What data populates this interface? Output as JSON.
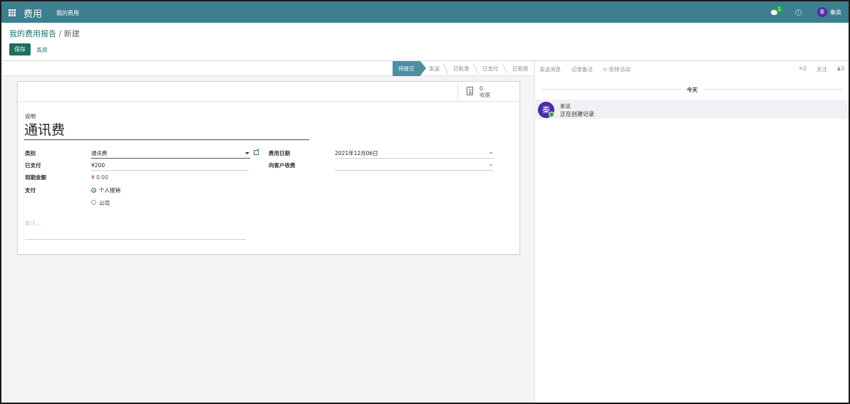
{
  "navbar": {
    "app_title": "费用",
    "menu_my_expenses": "我的费用",
    "chat_badge": "1",
    "user_avatar_initial": "秦",
    "user_name": "秦英"
  },
  "breadcrumb": {
    "parent": "我的费用报告",
    "separator": " / ",
    "current": "新建"
  },
  "buttons": {
    "save": "保存",
    "discard": "丢弃"
  },
  "statusbar": {
    "stages": [
      "待提交",
      "发送",
      "已批准",
      "已支付",
      "已拒绝"
    ],
    "active_index": 0
  },
  "button_box": {
    "receipt_count": "0",
    "receipt_label": "收据"
  },
  "form": {
    "description_label": "说明",
    "description_value": "通讯费",
    "category_label": "类别",
    "category_value": "通讯费",
    "paid_label": "已支付",
    "paid_value": "¥200",
    "due_label": "到期金额",
    "due_value": "¥ 0.00",
    "payment_label": "支付",
    "payment_options": [
      "个人报销",
      "公司"
    ],
    "payment_selected": "个人报销",
    "expense_date_label": "费用日期",
    "expense_date_value": "2021年12月06日",
    "customer_label": "向客户收费",
    "customer_value": "",
    "notes_placeholder": "备注..."
  },
  "chatter": {
    "send_message": "发送消息",
    "log_note": "记录备注",
    "schedule_activity": "安排活动",
    "attachments_count": "0",
    "follow": "关注",
    "followers_count": "0",
    "today": "今天",
    "message": {
      "avatar_initial": "秦",
      "author": "秦英",
      "body": "正在创建记录"
    }
  },
  "colors": {
    "navbar": "#3d7f8f",
    "primary": "#1f6f5f",
    "link": "#1f6f7c",
    "active_stage": "#4b8fa0",
    "avatar": "#4c2da5",
    "online": "#28a745"
  }
}
